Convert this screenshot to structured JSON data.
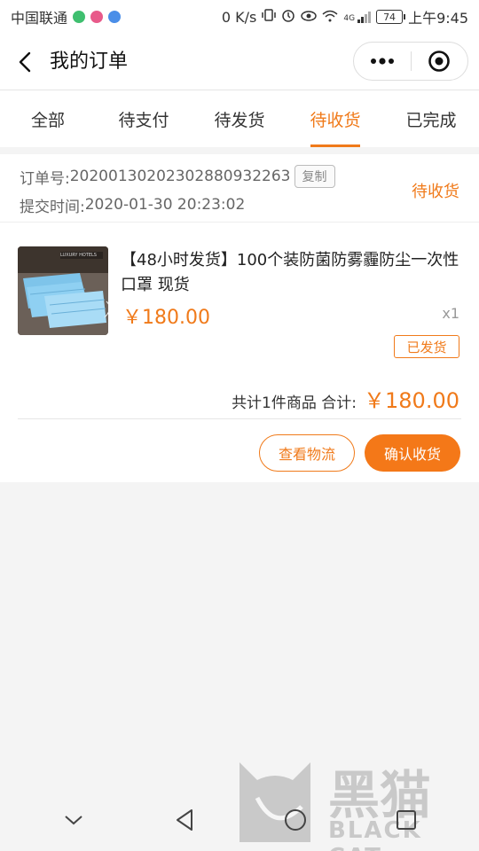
{
  "status_bar": {
    "carrier": "中国联通",
    "speed": "0 K/s",
    "battery": "74",
    "network": "4G",
    "time": "上午9:45"
  },
  "header": {
    "title": "我的订单",
    "more_icon": "more-dots-icon",
    "close_icon": "target-close-icon"
  },
  "tabs": [
    {
      "label": "全部",
      "active": false
    },
    {
      "label": "待支付",
      "active": false
    },
    {
      "label": "待发货",
      "active": false
    },
    {
      "label": "待收货",
      "active": true
    },
    {
      "label": "已完成",
      "active": false
    }
  ],
  "order": {
    "number_label": "订单号:",
    "number": "20200130202302880932263",
    "copy_label": "复制",
    "time_label": "提交时间:",
    "time": "2020-01-30 20:23:02",
    "status": "待收货",
    "product": {
      "title": "【48小时发货】100个装防菌防雾霾防尘一次性口罩 现货",
      "price": "￥180.00",
      "qty": "x1",
      "badge": "已发货",
      "thumb_text": "LUXURY HOTELS"
    },
    "total_label": "共计1件商品 合计:",
    "total_amount": "￥180.00",
    "btn_logistics": "查看物流",
    "btn_confirm": "确认收货"
  },
  "watermark": {
    "cn": "黑猫",
    "en": "BLACK CAT"
  },
  "colors": {
    "accent": "#f07a1a",
    "background": "#f4f4f4"
  }
}
